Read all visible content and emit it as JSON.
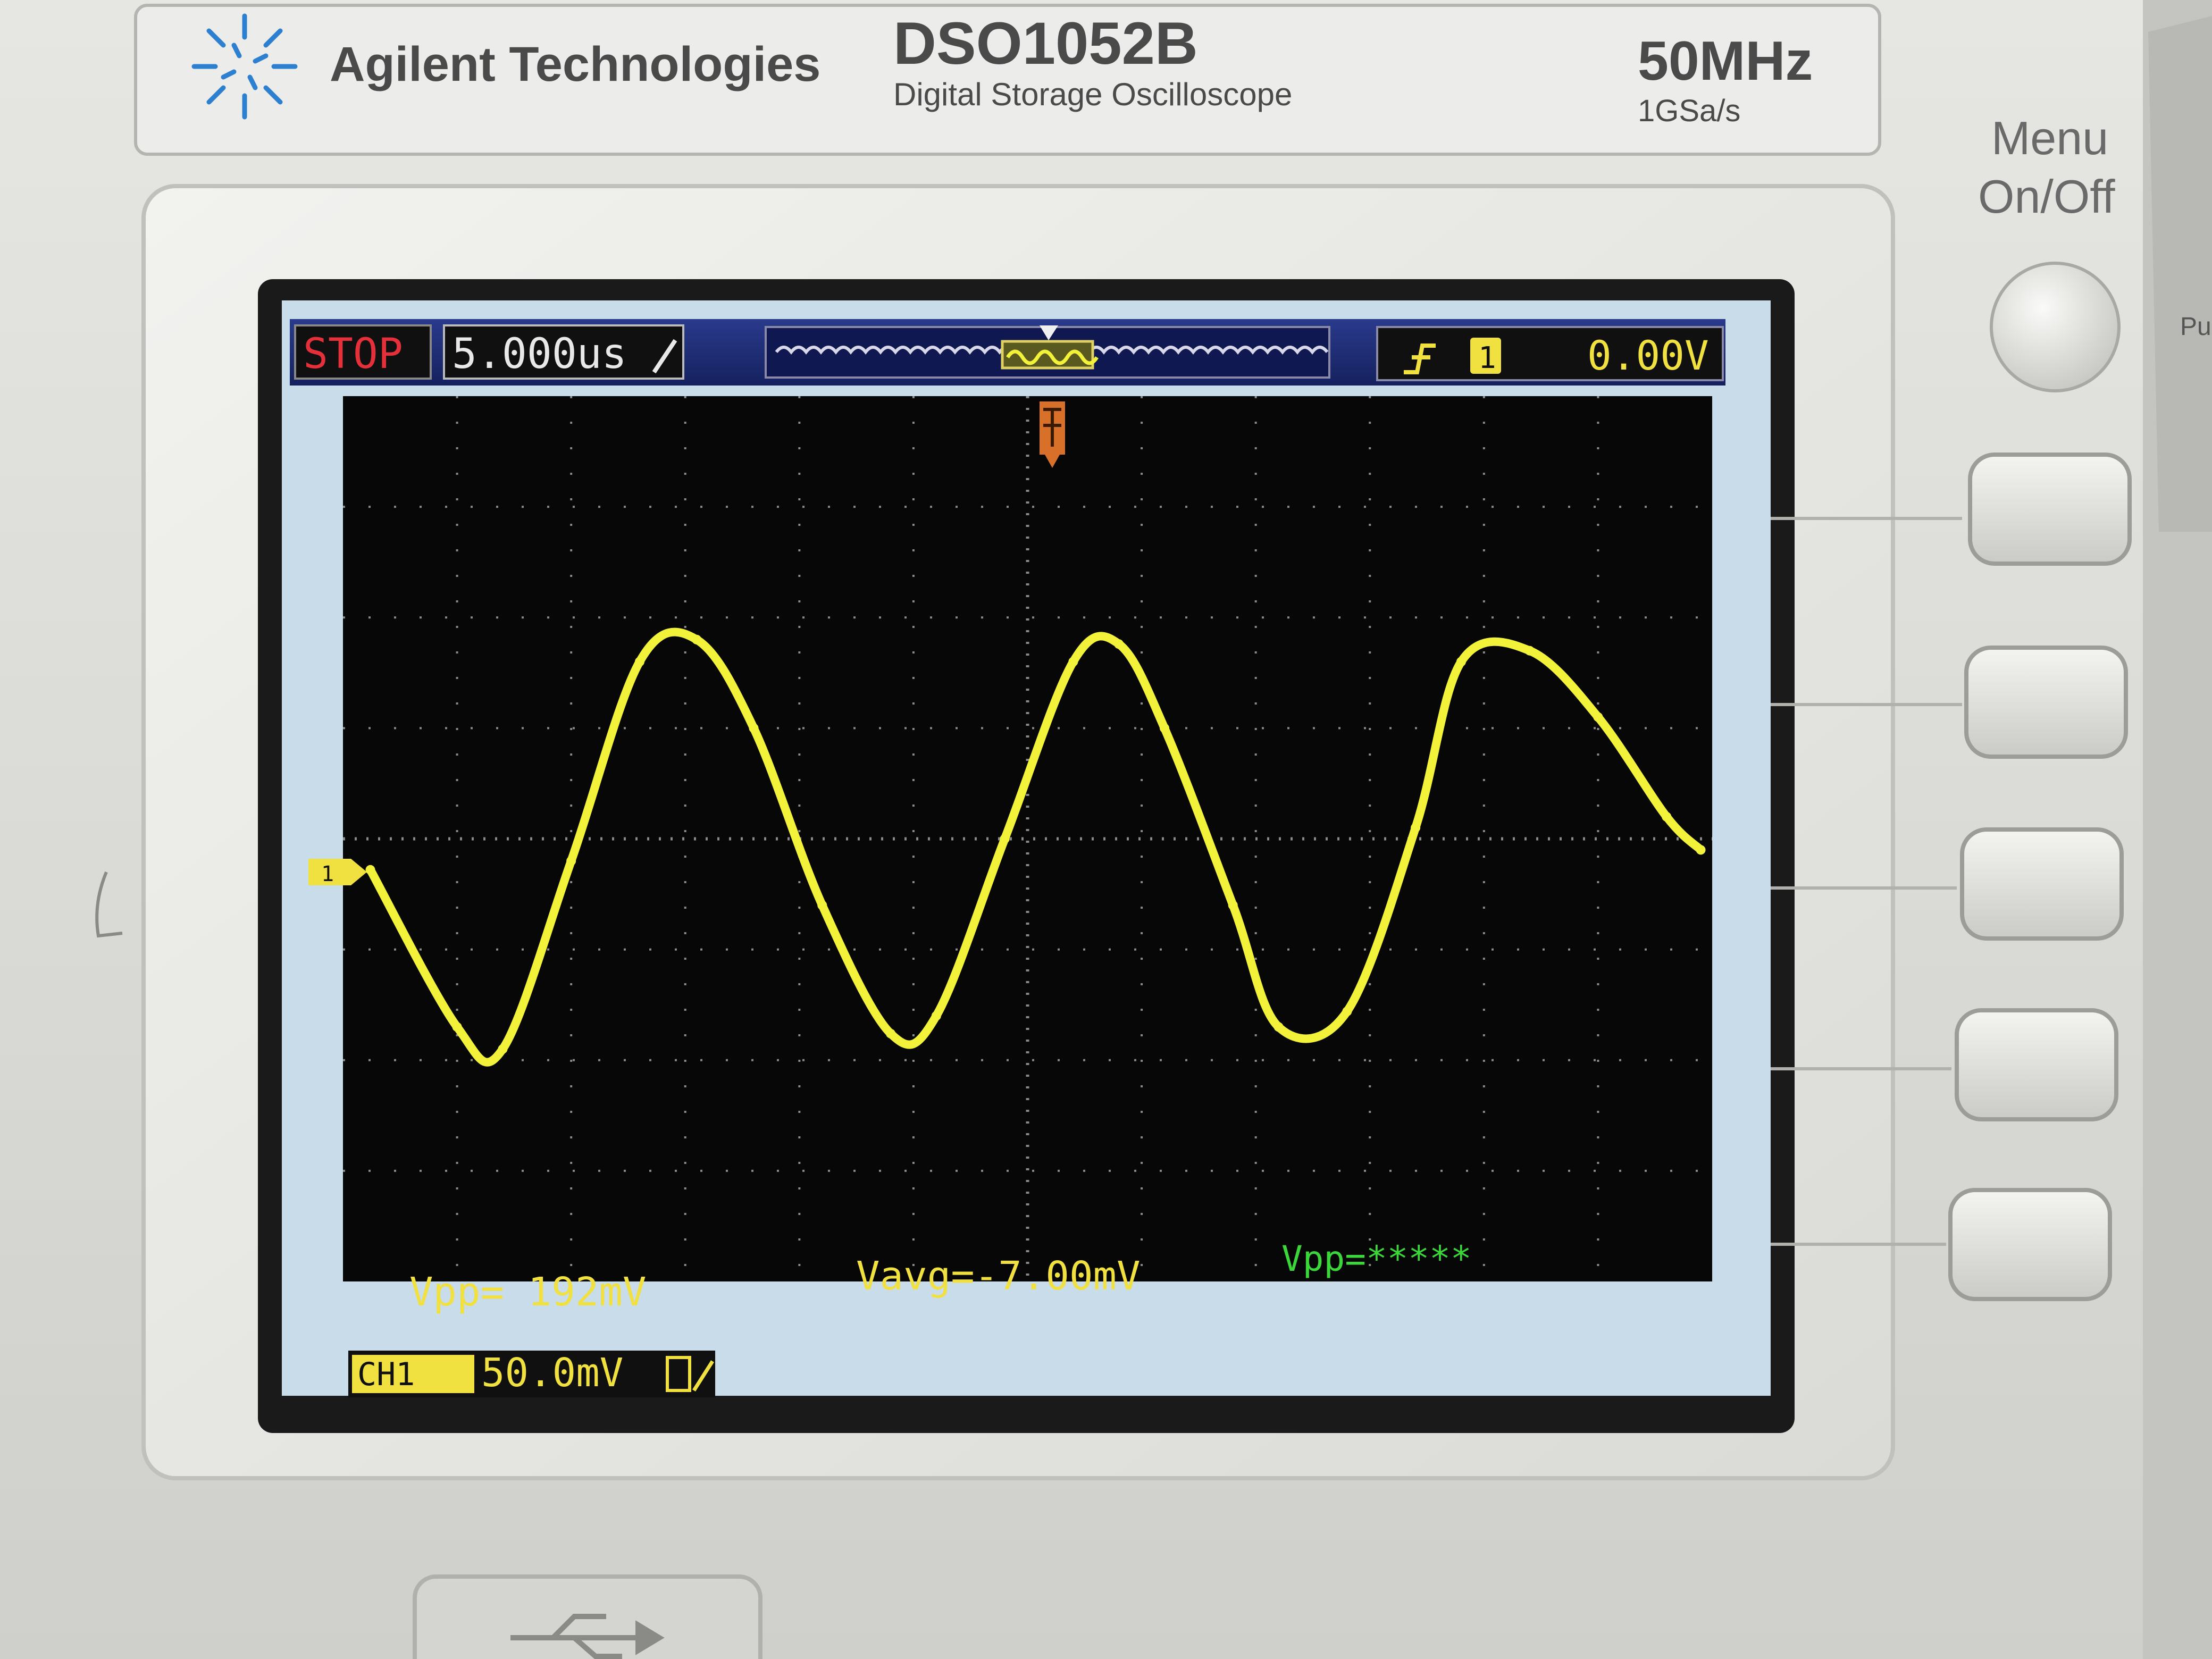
{
  "brand": {
    "company": "Agilent Technologies",
    "model": "DSO1052B",
    "description": "Digital Storage Oscilloscope",
    "bandwidth": "50MHz",
    "sample_rate": "1GSa/s"
  },
  "side_panel": {
    "menu_label_line1": "Menu",
    "menu_label_line2": "On/Off",
    "edge_label": "Pu"
  },
  "screen": {
    "run_state": "STOP",
    "timebase": "5.000us",
    "trigger_source": "1",
    "trigger_level": "0.00V",
    "channel_marker": "1",
    "measurements": {
      "vpp_ch1": "Vpp= 192mV",
      "vavg": "Vavg=-7.00mV",
      "vpp_ch2": "Vpp=*****"
    },
    "channel_label": "CH1",
    "channel_scale": "50.0mV",
    "colors": {
      "trace": "#f2f23a",
      "measure_ch1": "#f0e040",
      "measure_ch2": "#3ad63a",
      "stop_badge": "#e4303a",
      "status_bar": "#1c2c78",
      "grid_dot": "#8a8a8a"
    }
  },
  "chart_data": {
    "type": "line",
    "title": "",
    "xlabel": "",
    "ylabel": "",
    "x_unit": "us",
    "y_unit": "mV",
    "xlim": [
      -30,
      30
    ],
    "ylim": [
      -200,
      200
    ],
    "grid": true,
    "series": [
      {
        "x": [
          -28.8,
          -25.0,
          -23.0,
          -20.0,
          -17.0,
          -14.5,
          -12.0,
          -9.0,
          -6.0,
          -4.0,
          -1.0,
          2.0,
          4.0,
          6.0,
          9.0,
          11.0,
          14.0,
          17.0,
          19.0,
          22.0,
          25.0,
          28.0,
          29.5
        ],
        "y": [
          -14,
          -85,
          -95,
          -10,
          80,
          90,
          50,
          -30,
          -88,
          -80,
          0,
          80,
          88,
          50,
          -30,
          -85,
          -78,
          5,
          80,
          85,
          55,
          10,
          -5
        ]
      }
    ]
  }
}
